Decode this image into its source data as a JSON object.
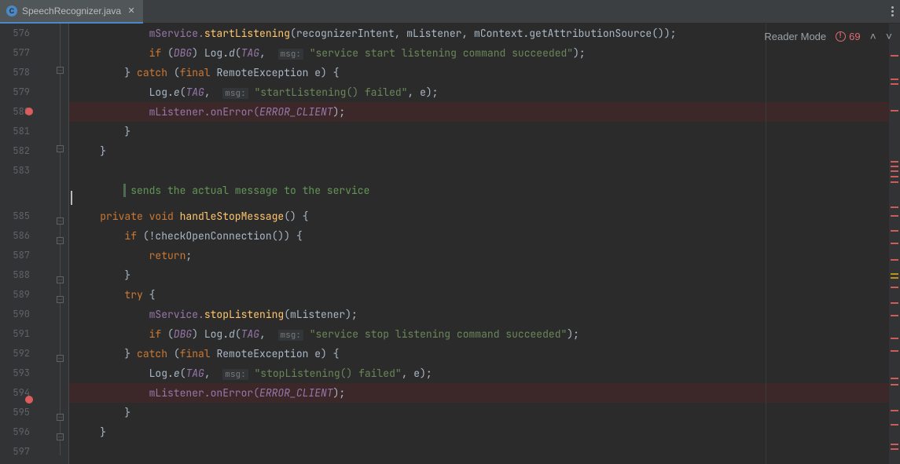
{
  "tab": {
    "filename": "SpeechRecognizer.java",
    "icon_letter": "C"
  },
  "header": {
    "reader_mode": "Reader Mode",
    "error_count": "69"
  },
  "gutter": {
    "lines": [
      "576",
      "577",
      "578",
      "579",
      "580",
      "581",
      "582",
      "583",
      "",
      "585",
      "586",
      "587",
      "588",
      "589",
      "590",
      "591",
      "592",
      "593",
      "594",
      "595",
      "596",
      "597"
    ]
  },
  "code": {
    "l576": {
      "a": "mService.",
      "b": "startListening",
      "c": "(recognizerIntent, mListener, mContext.getAttributionSource());"
    },
    "l577": {
      "a": "if",
      "b": " (",
      "c": "DBG",
      "d": ") Log.",
      "e": "d",
      "f": "(",
      "g": "TAG",
      "h": ", ",
      "hint": "msg:",
      "i": " \"service start listening command succeeded\"",
      "j": ");"
    },
    "l578": {
      "a": "} ",
      "b": "catch",
      "c": " (",
      "d": "final",
      "e": " RemoteException e) {"
    },
    "l579": {
      "a": "Log.",
      "b": "e",
      "c": "(",
      "d": "TAG",
      "e": ", ",
      "hint": "msg:",
      "f": " \"startListening() failed\"",
      "g": ", e);"
    },
    "l580": {
      "a": "mListener.onError(",
      "b": "ERROR_CLIENT",
      "c": ");"
    },
    "l581": {
      "a": "}"
    },
    "l582": {
      "a": "}"
    },
    "l583": {
      "a": ""
    },
    "comment": {
      "text": "sends the actual message to the service"
    },
    "l585": {
      "a": "private void ",
      "b": "handleStopMessage",
      "c": "() {"
    },
    "l586": {
      "a": "if",
      "b": " (!checkOpenConnection()) {"
    },
    "l587": {
      "a": "return",
      "b": ";"
    },
    "l588": {
      "a": "}"
    },
    "l589": {
      "a": "try",
      "b": " {"
    },
    "l590": {
      "a": "mService.",
      "b": "stopListening",
      "c": "(mListener);"
    },
    "l591": {
      "a": "if",
      "b": " (",
      "c": "DBG",
      "d": ") Log.",
      "e": "d",
      "f": "(",
      "g": "TAG",
      "h": ", ",
      "hint": "msg:",
      "i": " \"service stop listening command succeeded\"",
      "j": ");"
    },
    "l592": {
      "a": "} ",
      "b": "catch",
      "c": " (",
      "d": "final",
      "e": " RemoteException e) {"
    },
    "l593": {
      "a": "Log.",
      "b": "e",
      "c": "(",
      "d": "TAG",
      "e": ", ",
      "hint": "msg:",
      "f": " \"stopListening() failed\"",
      "g": ", e);"
    },
    "l594": {
      "a": "mListener.onError(",
      "b": "ERROR_CLIENT",
      "c": ");"
    },
    "l595": {
      "a": "}"
    },
    "l596": {
      "a": "}"
    },
    "l597": {
      "a": ""
    }
  }
}
